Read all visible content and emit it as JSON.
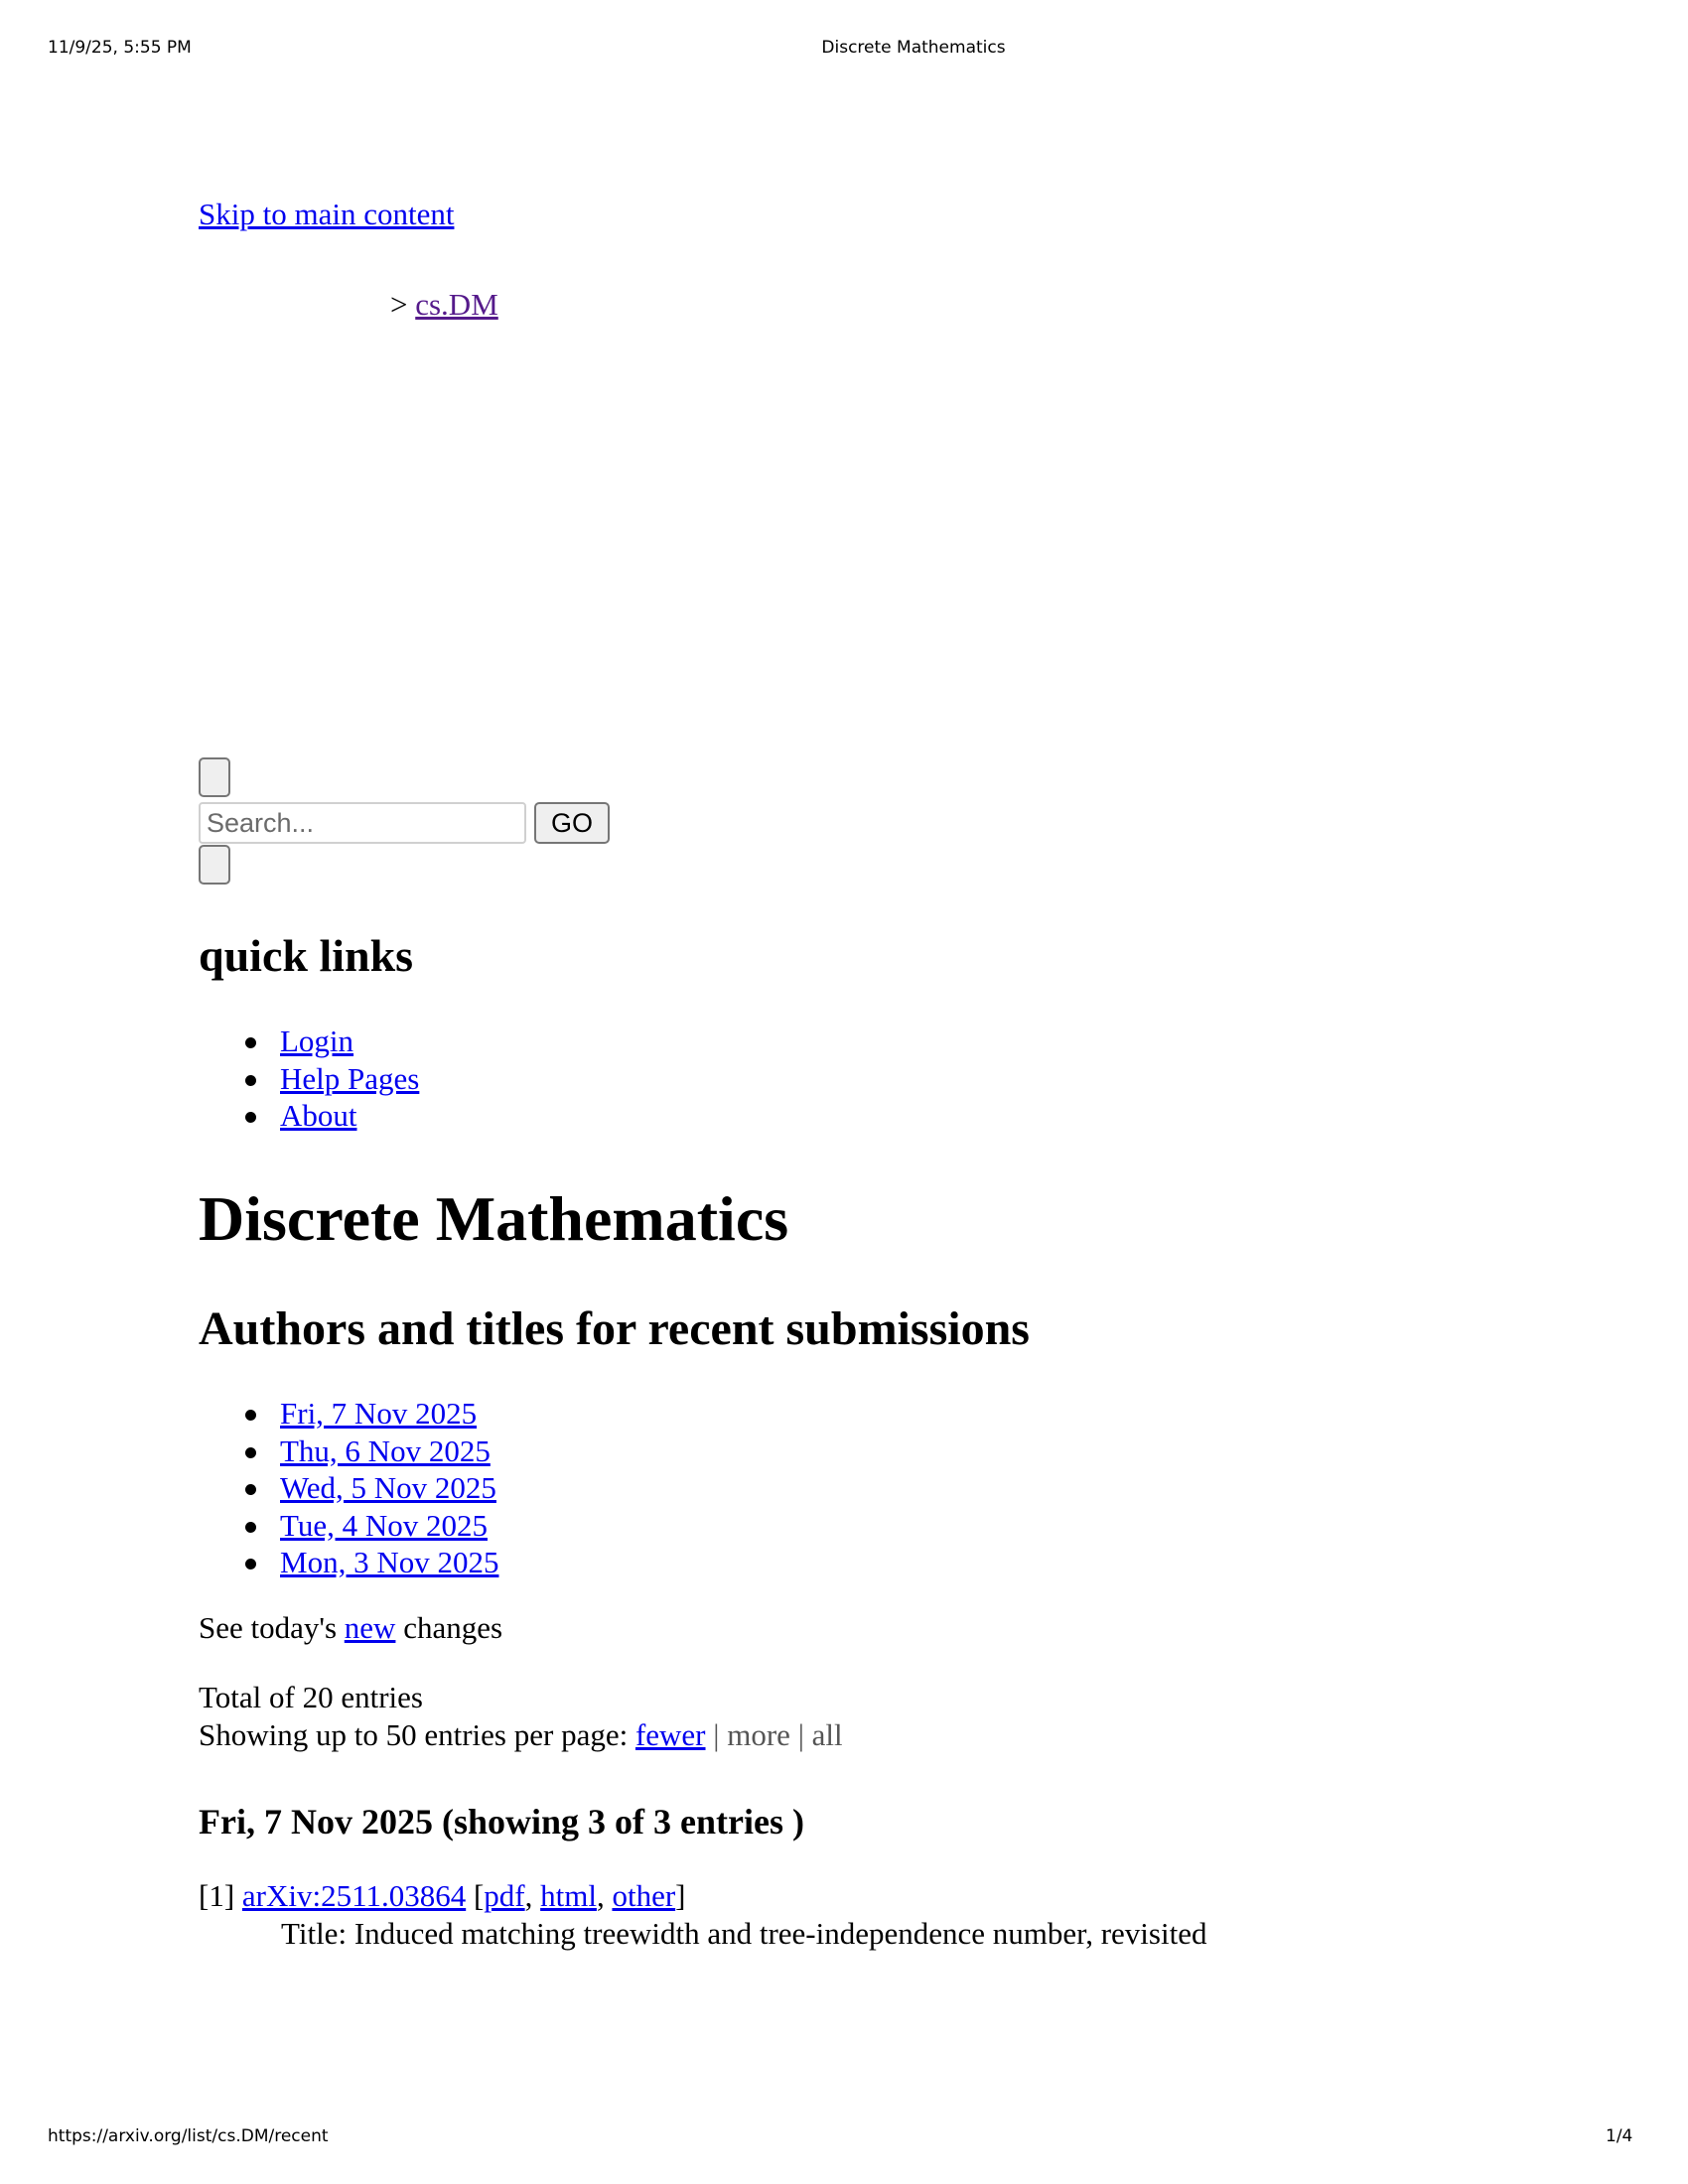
{
  "print_header": {
    "datetime": "11/9/25, 5:55 PM",
    "title": "Discrete Mathematics"
  },
  "print_footer": {
    "url": "https://arxiv.org/list/cs.DM/recent",
    "page": "1/4"
  },
  "skip_link": "Skip to main content",
  "breadcrumb": {
    "separator": ">",
    "current": "cs.DM"
  },
  "search": {
    "placeholder": "Search...",
    "go_label": "GO"
  },
  "quick_links": {
    "heading": "quick links",
    "items": [
      "Login",
      "Help Pages",
      "About"
    ]
  },
  "page_title": "Discrete Mathematics",
  "subtitle": "Authors and titles for recent submissions",
  "dates": [
    "Fri, 7 Nov 2025",
    "Thu, 6 Nov 2025",
    "Wed, 5 Nov 2025",
    "Tue, 4 Nov 2025",
    "Mon, 3 Nov 2025"
  ],
  "new_changes": {
    "prefix": "See today's",
    "link": "new",
    "suffix": "changes"
  },
  "totals": {
    "total_text": "Total of 20 entries",
    "showing_prefix": "Showing up to 50 entries per page:",
    "fewer": "fewer",
    "sep": "|",
    "more": "more",
    "all": "all"
  },
  "day_heading": "Fri, 7 Nov 2025 (showing 3 of 3 entries )",
  "entries": [
    {
      "index": "[1]",
      "id": "arXiv:2511.03864",
      "open_bracket": "[",
      "pdf": "pdf",
      "html": "html",
      "other": "other",
      "close_bracket": "]",
      "comma": ",",
      "title_label": "Title:",
      "title": "Induced matching treewidth and tree-independence number, revisited"
    }
  ],
  "colors": {
    "link": "#0000ee",
    "visited": "#551a8b",
    "muted": "#555555"
  }
}
